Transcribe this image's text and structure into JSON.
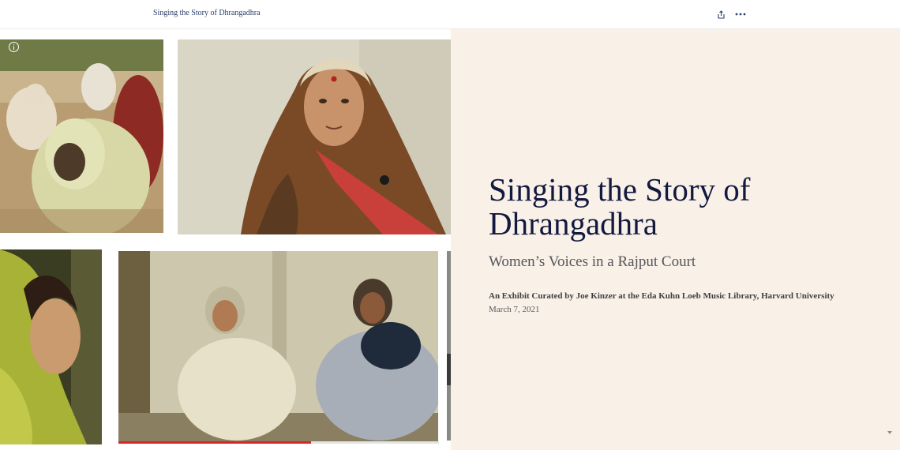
{
  "header": {
    "story_title": "Singing the Story of Dhrangadhra",
    "share_icon": "share-icon",
    "more_icon": "more-options-icon"
  },
  "cover": {
    "title": "Singing the Story of Dhrangadhra",
    "subtitle": "Women’s Voices in a Rajput Court",
    "byline": "An Exhibit Curated by Joe Kinzer at the Eda Kuhn Loeb Music Library, Harvard University",
    "date": "March 7, 2021"
  },
  "media": {
    "info_icon": "info-icon",
    "video_progress": 0.6
  },
  "colors": {
    "title": "#13193f",
    "panel_bg": "#f9f1e8",
    "progress": "#d9262a"
  }
}
